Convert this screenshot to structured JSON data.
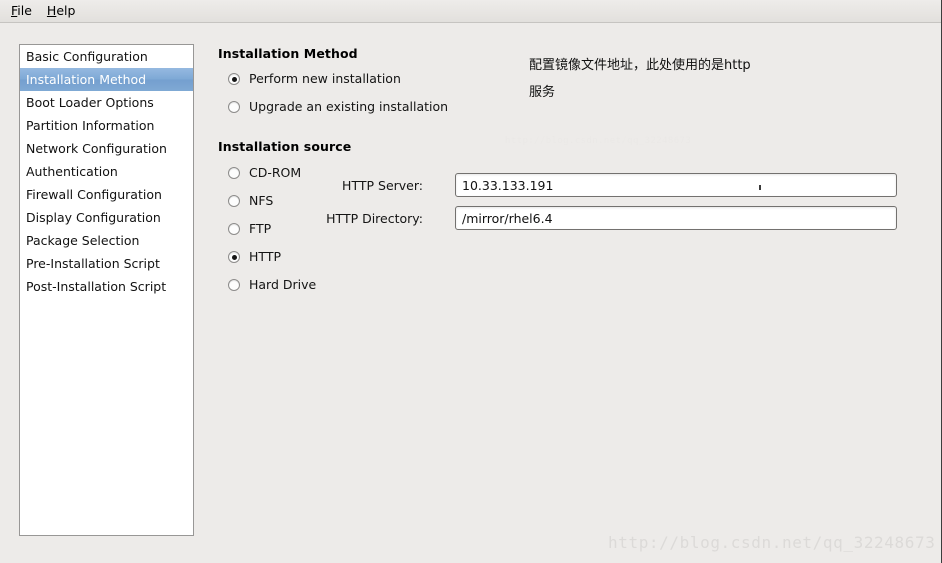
{
  "menubar": {
    "items": [
      {
        "mnemonic": "F",
        "rest": "ile",
        "name": "menu-file"
      },
      {
        "mnemonic": "H",
        "rest": "elp",
        "name": "menu-help"
      }
    ]
  },
  "sidebar": {
    "items": [
      {
        "label": "Basic Configuration",
        "selected": false
      },
      {
        "label": "Installation Method",
        "selected": true
      },
      {
        "label": "Boot Loader Options",
        "selected": false
      },
      {
        "label": "Partition Information",
        "selected": false
      },
      {
        "label": "Network Configuration",
        "selected": false
      },
      {
        "label": "Authentication",
        "selected": false
      },
      {
        "label": "Firewall Configuration",
        "selected": false
      },
      {
        "label": "Display Configuration",
        "selected": false
      },
      {
        "label": "Package Selection",
        "selected": false
      },
      {
        "label": "Pre-Installation Script",
        "selected": false
      },
      {
        "label": "Post-Installation Script",
        "selected": false
      }
    ],
    "selection_color": "#7ea9d6"
  },
  "installation_method": {
    "title": "Installation Method",
    "options": [
      {
        "label": "Perform new installation",
        "checked": true
      },
      {
        "label": "Upgrade an existing installation",
        "checked": false
      }
    ]
  },
  "installation_source": {
    "title": "Installation source",
    "options": [
      {
        "label": "CD-ROM",
        "checked": false
      },
      {
        "label": "NFS",
        "checked": false
      },
      {
        "label": "FTP",
        "checked": false
      },
      {
        "label": "HTTP",
        "checked": true
      },
      {
        "label": "Hard Drive",
        "checked": false
      }
    ],
    "fields": [
      {
        "label": "HTTP Server:",
        "value": "10.33.133.191"
      },
      {
        "label": "HTTP Directory:",
        "value": "/mirror/rhel6.4"
      }
    ]
  },
  "annotation": {
    "line1": "配置镜像文件地址，此处使用的是http",
    "line2": "服务"
  },
  "watermark": {
    "text": "http://blog.csdn.net/qq_32248673",
    "color": "#dcdad8"
  }
}
